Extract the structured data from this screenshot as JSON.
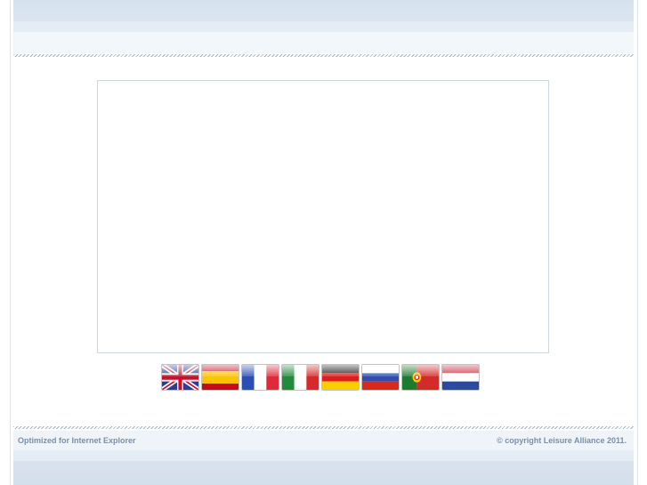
{
  "footer": {
    "left_text": "Optimized for Internet Explorer",
    "right_text": "© copyright Leisure Alliance 2011."
  },
  "languages": [
    {
      "code": "en",
      "icon": "uk-flag-icon"
    },
    {
      "code": "es",
      "icon": "spain-flag-icon"
    },
    {
      "code": "fr",
      "icon": "france-flag-icon"
    },
    {
      "code": "it",
      "icon": "italy-flag-icon"
    },
    {
      "code": "de",
      "icon": "germany-flag-icon"
    },
    {
      "code": "ru",
      "icon": "russia-flag-icon"
    },
    {
      "code": "pt",
      "icon": "portugal-flag-icon"
    },
    {
      "code": "nl",
      "icon": "netherlands-flag-icon"
    }
  ],
  "colors": {
    "band": "#d6e2ee",
    "footer_text": "#7a8fa8",
    "box_border": "#cfd7df"
  }
}
